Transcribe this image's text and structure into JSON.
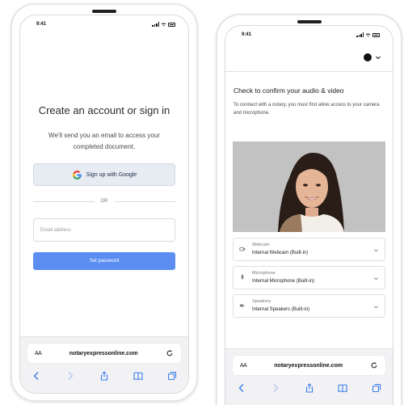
{
  "colors": {
    "primary_button": "#5b8ef0",
    "google_button_bg": "#e7ebf2",
    "browser_bar": "#f2f2f4"
  },
  "left_phone": {
    "status_time": "9:41",
    "title": "Create an account or sign in",
    "subtitle": "We'll send you an email to access your completed document.",
    "google_button": {
      "label": "Sign up with Google",
      "icon": "google-g-icon"
    },
    "divider_text": "OR",
    "email_input": {
      "placeholder": "Email address",
      "value": ""
    },
    "set_password_button": "Set password",
    "browser": {
      "reader_label": "AA",
      "url": "notaryexpressonline.com",
      "icons": [
        "back-icon",
        "forward-icon",
        "share-icon",
        "bookmarks-icon",
        "tabs-icon",
        "reload-icon"
      ]
    }
  },
  "right_phone": {
    "status_time": "9:41",
    "title": "Check to confirm your audio & video",
    "subtitle": "To connect with a notary, you must first allow access to your camera and microphone.",
    "devices": [
      {
        "label": "Webcam",
        "value": "Internal Webcam (Built-in)",
        "icon": "camera-icon"
      },
      {
        "label": "Microphone",
        "value": "Internal Microphone (Built-in)",
        "icon": "microphone-icon"
      },
      {
        "label": "Speakers",
        "value": "Internal Speakers (Built-in)",
        "icon": "speaker-icon"
      }
    ],
    "browser": {
      "reader_label": "AA",
      "url": "notaryexpressonline.com"
    }
  }
}
